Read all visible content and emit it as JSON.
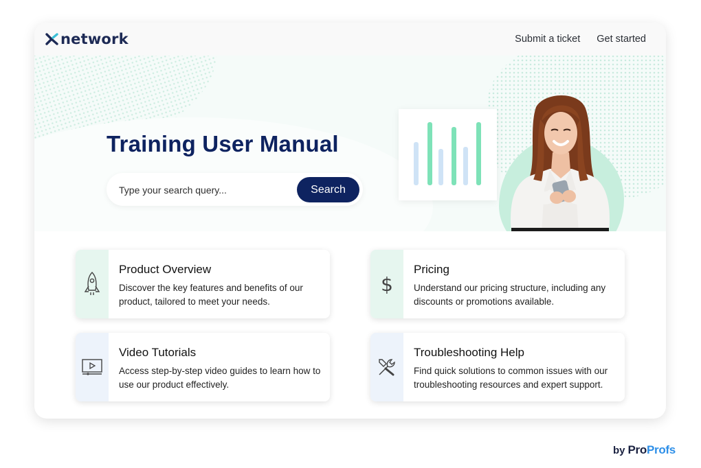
{
  "header": {
    "logo_text": "network",
    "nav": [
      "Submit a ticket",
      "Get started"
    ]
  },
  "hero": {
    "title": "Training User Manual",
    "search_placeholder": "Type your search query...",
    "search_button": "Search"
  },
  "tiles": [
    {
      "title": "Product Overview",
      "desc": "Discover the key features and benefits of our product, tailored to meet your needs.",
      "icon": "rocket-icon",
      "strip_color": "#e6f6ef"
    },
    {
      "title": "Pricing",
      "desc": "Understand our pricing structure, including any discounts or promotions available.",
      "icon": "dollar-icon",
      "strip_color": "#e6f6ef"
    },
    {
      "title": "Video Tutorials",
      "desc": "Access step-by-step video guides to learn how to use our product effectively.",
      "icon": "video-player-icon",
      "strip_color": "#edf3fb"
    },
    {
      "title": "Troubleshooting Help",
      "desc": "Find quick solutions to common issues with our troubleshooting resources and expert support.",
      "icon": "tools-icon",
      "strip_color": "#edf3fb"
    }
  ],
  "footer": {
    "by_text": "by",
    "brand_pro": "Pro",
    "brand_profs": "Profs"
  },
  "colors": {
    "navy": "#0e2360",
    "accent_green": "#7ee2b8",
    "light_blue": "#cfe3f6",
    "brand_blue": "#2d8fe8"
  }
}
